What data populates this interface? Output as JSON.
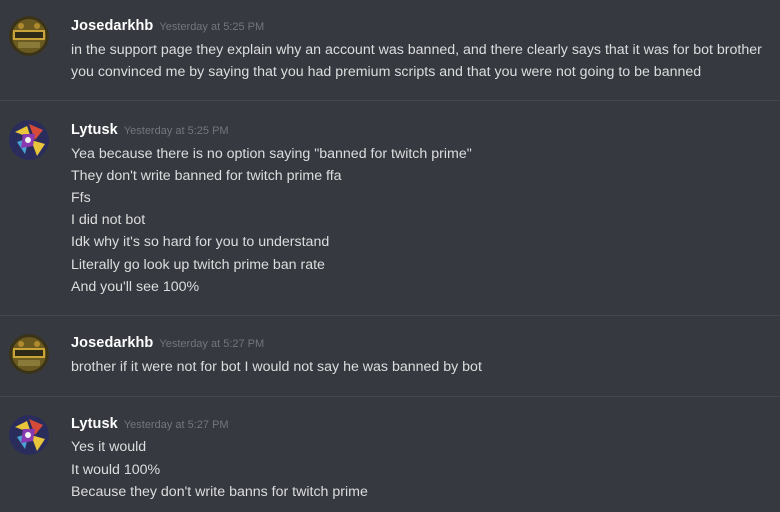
{
  "messages": [
    {
      "author": "Josedarkhb",
      "timestamp": "Yesterday at 5:25 PM",
      "avatar_icon": "gold-badge-avatar",
      "lines": [
        "in the support page they explain why an account was banned, and there clearly says that it was for bot brother",
        "you convinced me by saying that you had premium scripts and that you were not going to be banned"
      ]
    },
    {
      "author": "Lytusk",
      "timestamp": "Yesterday at 5:25 PM",
      "avatar_icon": "colorful-abstract-avatar",
      "lines": [
        "Yea because there is no option saying \"banned for twitch prime\"",
        "They don't write banned for twitch prime ffa",
        "Ffs",
        "I did not bot",
        "Idk why it's so hard for you to understand",
        "Literally go look up twitch prime ban rate",
        "And you'll see 100%"
      ]
    },
    {
      "author": "Josedarkhb",
      "timestamp": "Yesterday at 5:27 PM",
      "avatar_icon": "gold-badge-avatar",
      "lines": [
        "brother if it were not for bot I would not say he was banned by bot"
      ]
    },
    {
      "author": "Lytusk",
      "timestamp": "Yesterday at 5:27 PM",
      "avatar_icon": "colorful-abstract-avatar",
      "lines": [
        "Yes it would",
        "It would 100%",
        "Because they don't write banns for twitch prime"
      ]
    }
  ],
  "colors": {
    "background": "#36393f",
    "username": "#ffffff",
    "timestamp": "#72767d",
    "message_text": "#dcddde",
    "divider": "#42454a"
  }
}
